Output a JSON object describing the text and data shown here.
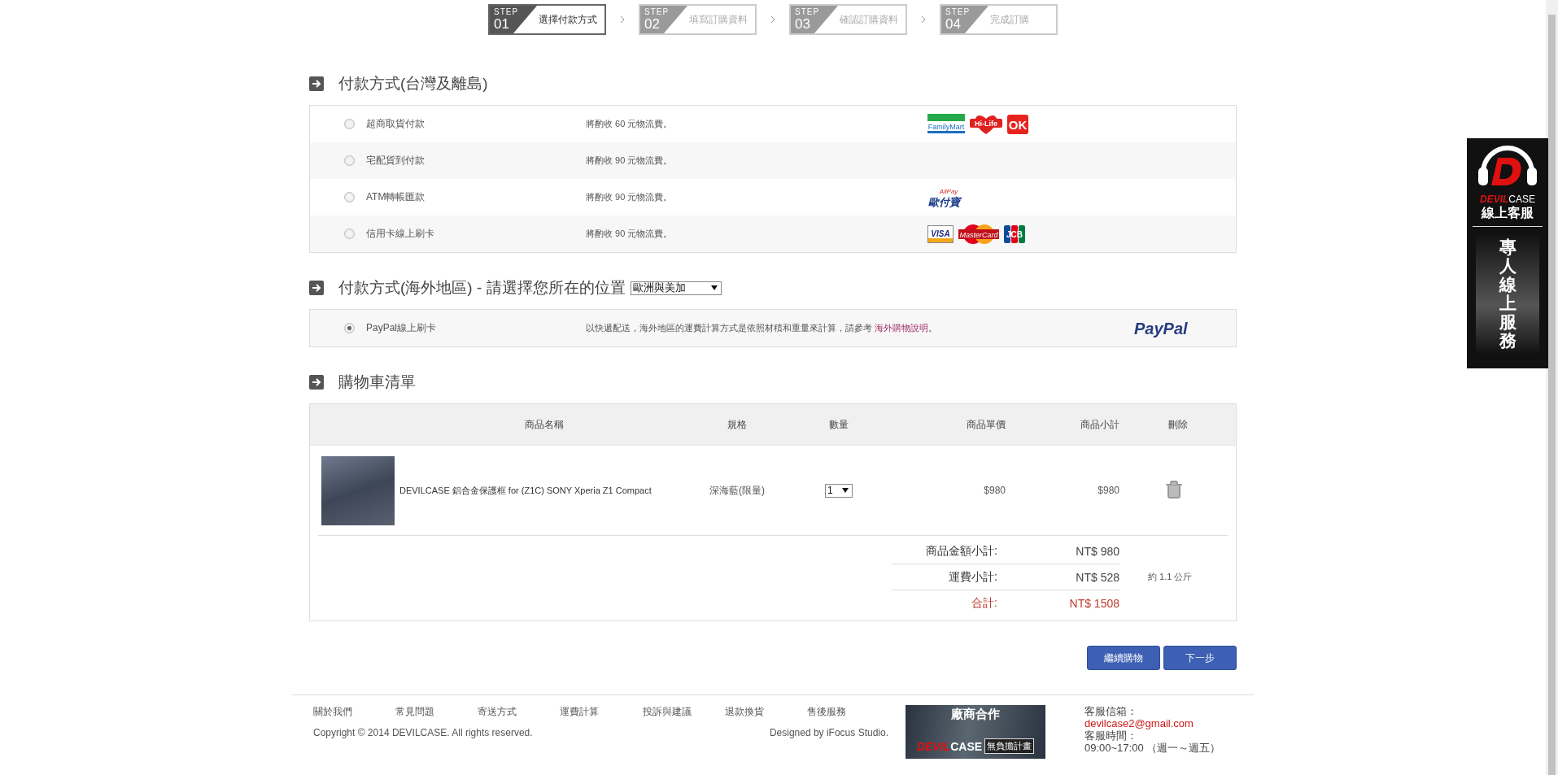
{
  "steps": [
    {
      "step_label": "STEP",
      "number": "01",
      "label": "選擇付款方式",
      "selected": true
    },
    {
      "step_label": "STEP",
      "number": "02",
      "label": "填寫訂購資料",
      "selected": false
    },
    {
      "step_label": "STEP",
      "number": "03",
      "label": "確認訂購資料",
      "selected": false
    },
    {
      "step_label": "STEP",
      "number": "04",
      "label": "完成訂購",
      "selected": false
    }
  ],
  "domestic_payment": {
    "title": "付款方式(台灣及離島)",
    "options": [
      {
        "label": "超商取貨付款",
        "selected": false,
        "note": "將酌收 60 元物流費。",
        "logos": [
          {
            "kind": "familymart",
            "text": "FamilyMart"
          },
          {
            "kind": "hilife",
            "text": "Hi-Life"
          },
          {
            "kind": "ok",
            "text": "OK"
          }
        ]
      },
      {
        "label": "宅配貨到付款",
        "selected": false,
        "note": "將酌收 90 元物流費。"
      },
      {
        "label": "ATM轉帳匯款",
        "selected": false,
        "note": "將酌收 90 元物流費。",
        "logos": [
          {
            "kind": "allpay",
            "text": "歐付寶",
            "sub": "AllPay"
          }
        ]
      },
      {
        "label": "信用卡線上刷卡",
        "selected": false,
        "note": "將酌收 90 元物流費。",
        "logos": [
          {
            "kind": "visa",
            "text": "VISA"
          },
          {
            "kind": "mastercard",
            "text": "MasterCard"
          },
          {
            "kind": "jcb",
            "text": "JCB"
          }
        ]
      }
    ]
  },
  "overseas_payment": {
    "title": "付款方式(海外地區) - 請選擇您所在的位置",
    "region_select": {
      "value": "歐洲與美加"
    },
    "options": [
      {
        "label": "PayPal線上刷卡",
        "selected": true,
        "note": "以快遞配送，海外地區的運費計算方式是依照材積和重量來計算，請參考 ",
        "link": "海外購物說明",
        "note_end": "。",
        "logos": [
          {
            "kind": "paypal",
            "text": "PayPal"
          }
        ]
      }
    ]
  },
  "cart": {
    "title": "購物車清單",
    "columns": [
      "商品名稱",
      "規格",
      "數量",
      "商品單價",
      "商品小計",
      "刪除"
    ],
    "rows": [
      {
        "name": "DEVILCASE 鋁合金保護框 for (Z1C) SONY Xperia Z1 Compact",
        "spec": "深海藍(限量)",
        "quantity": "1",
        "unit_price": "$980",
        "subtotal": "$980"
      }
    ],
    "totals": [
      {
        "kind": "normal",
        "label": "商品金額小計:",
        "value": "NT$ 980"
      },
      {
        "kind": "normal",
        "label": "運費小計:",
        "value": "NT$ 528",
        "note": "約 1.1 公斤"
      },
      {
        "kind": "grand",
        "label": "合計:",
        "value": "NT$ 1508"
      }
    ]
  },
  "buttons": [
    "繼續購物",
    "下一步"
  ],
  "footer": {
    "links": [
      "關於我們",
      "常見問題",
      "寄送方式",
      "運費計算",
      "投訴與建議",
      "退款換貨",
      "售後服務"
    ],
    "copyright": "Copyright © 2014 DEVILCASE. All rights reserved.",
    "designer": "Designed by iFocus Studio.",
    "banner": {
      "title": "廠商合作",
      "brand_red": "DEVIL",
      "brand_white": "CASE",
      "tagline": "無負擔計畫"
    },
    "contact": [
      {
        "kind": "label",
        "text": "客服信箱："
      },
      {
        "kind": "email",
        "text": "devilcase2@gmail.com"
      },
      {
        "kind": "label",
        "text": "客服時間："
      },
      {
        "kind": "label",
        "text": "09:00~17:00 （週一～週五）"
      }
    ]
  },
  "support_widget": {
    "brand_red": "DEVIL",
    "brand_white": "CASE",
    "title": "線上客服",
    "vertical_text": "專人線上服務"
  }
}
